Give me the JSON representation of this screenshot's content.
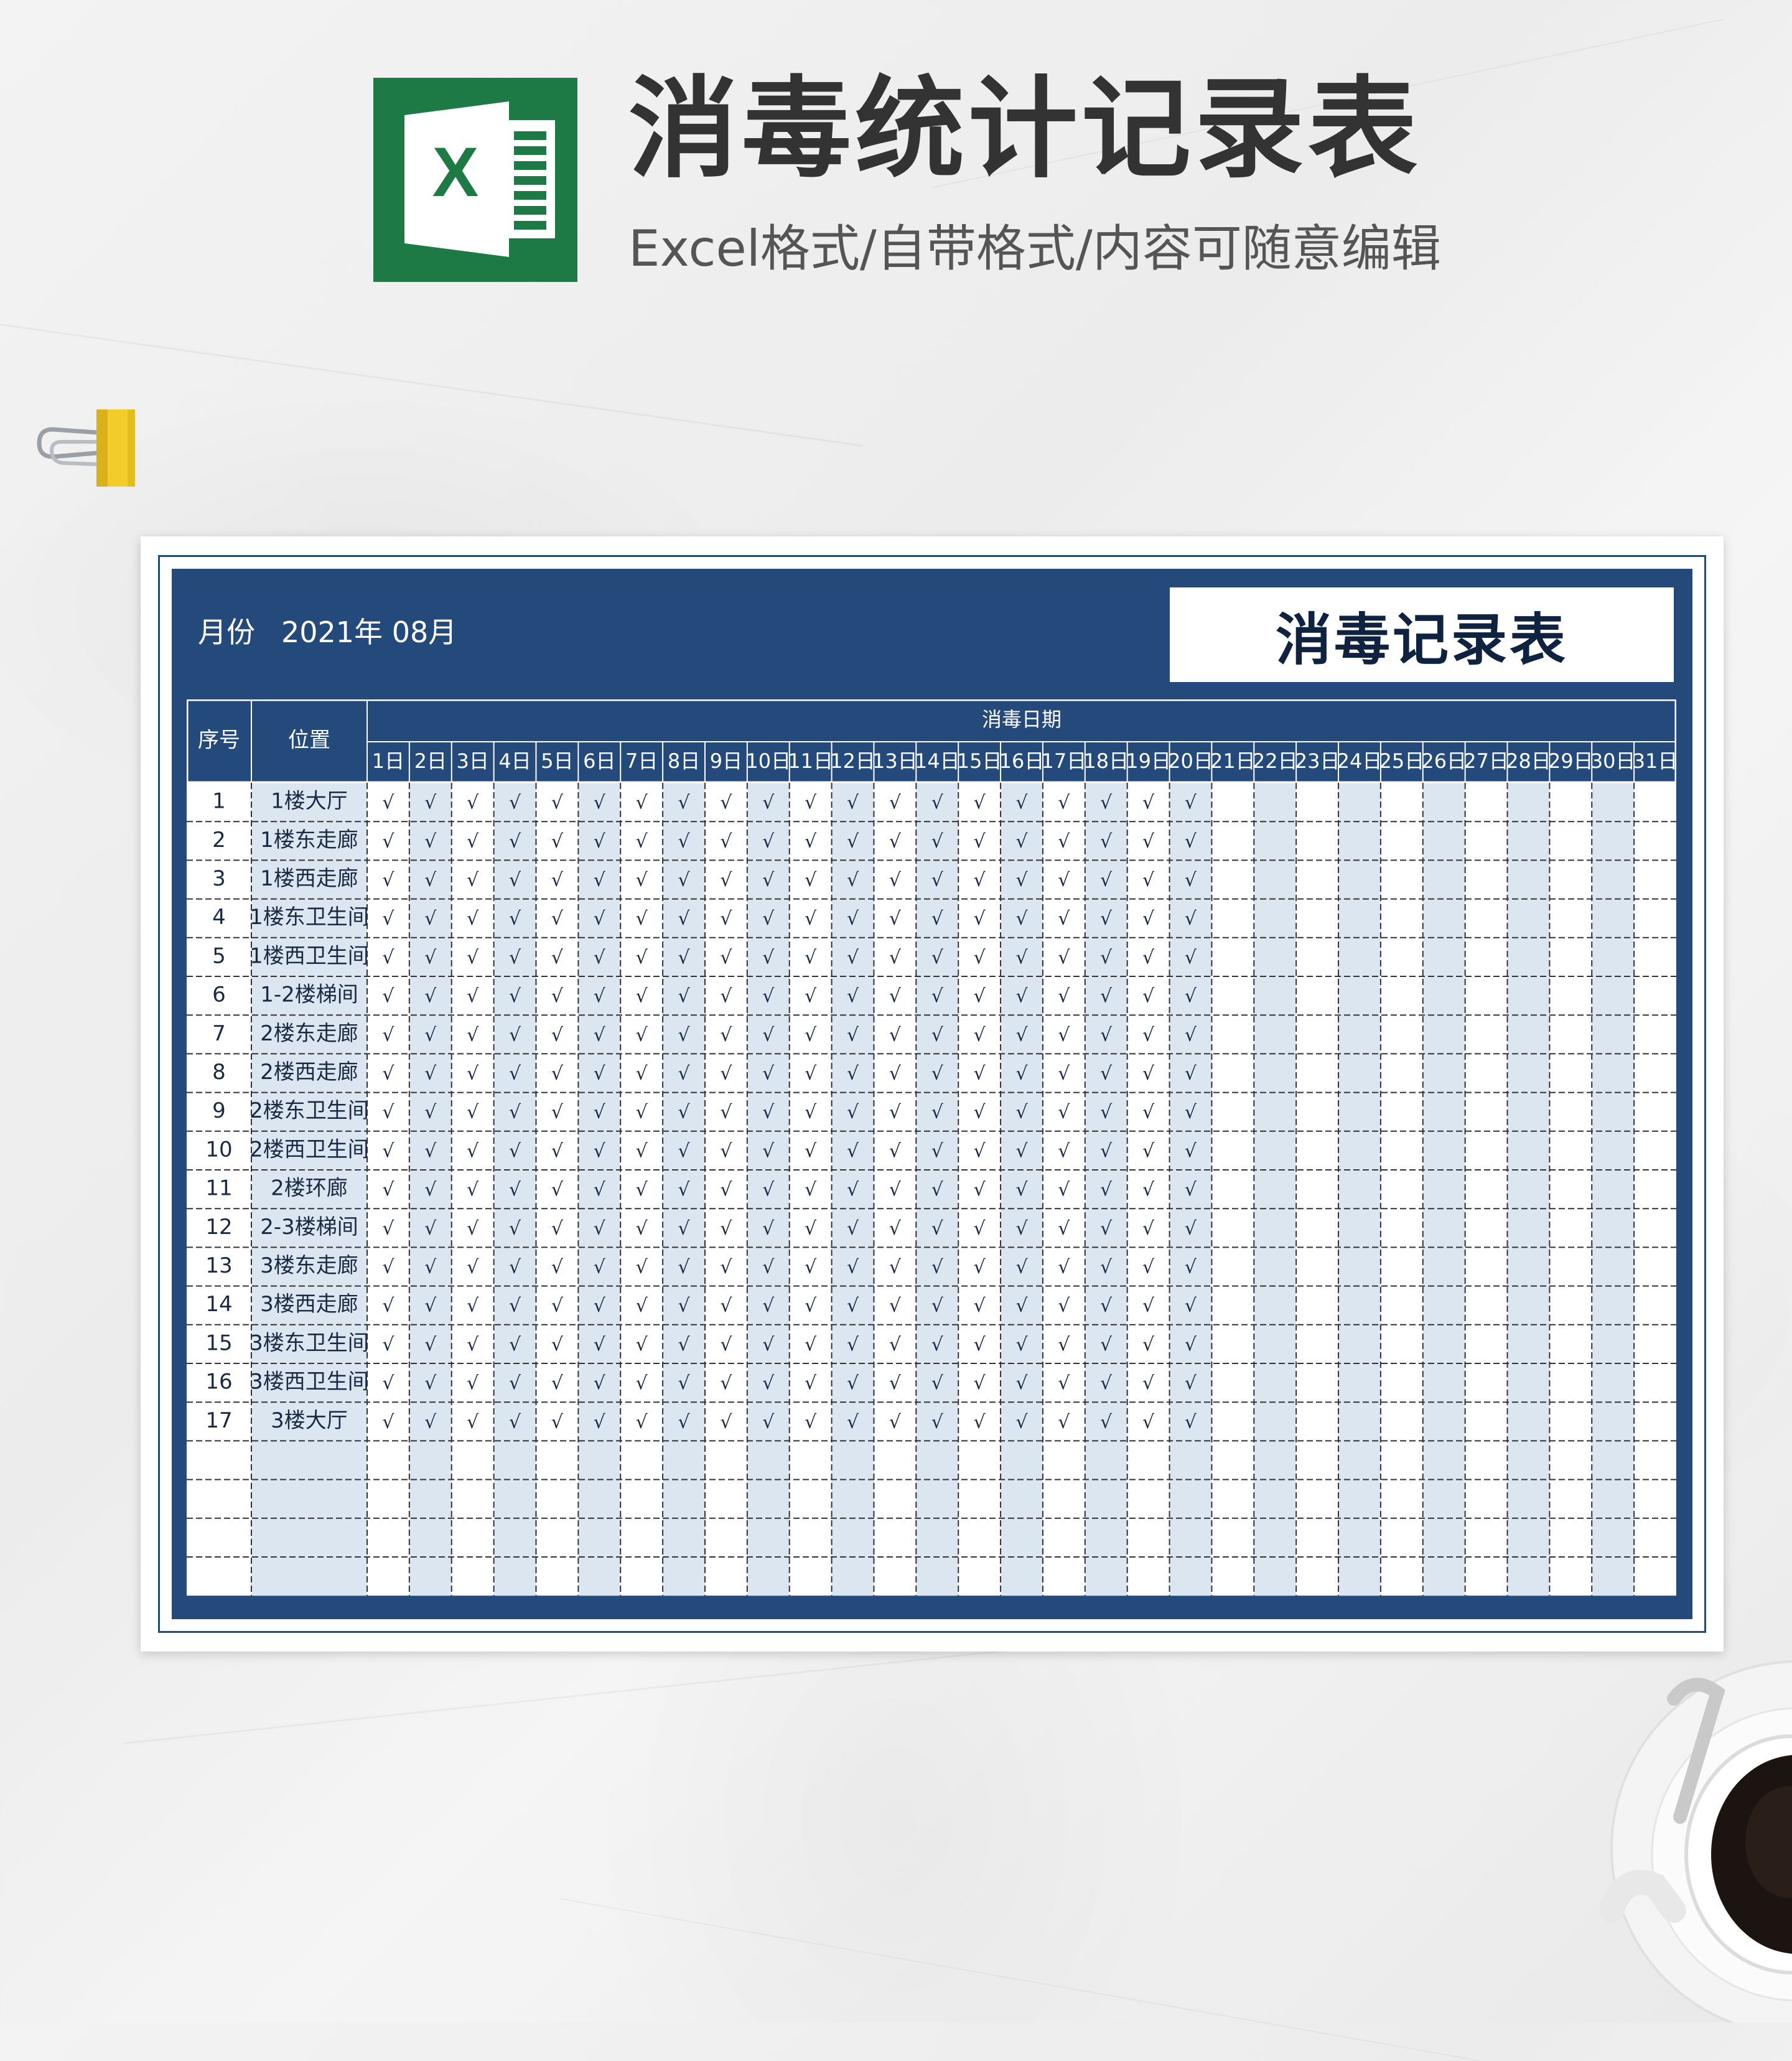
{
  "header": {
    "title": "消毒统计记录表",
    "subtitle": "Excel格式/自带格式/内容可随意编辑",
    "logo_letter": "X"
  },
  "colors": {
    "excel_green": "#1e7a45",
    "panel_navy": "#244a7c",
    "stripe_blue": "#dce6f1"
  },
  "icons": [
    "excel-logo-icon",
    "binder-clip-icon",
    "coffee-cup-icon"
  ],
  "sheet": {
    "month_label": "月份",
    "month_value": "2021年 08月",
    "title": "消毒记录表",
    "header_seq": "序号",
    "header_location": "位置",
    "header_dates": "消毒日期",
    "check_mark": "√",
    "days": [
      "1日",
      "2日",
      "3日",
      "4日",
      "5日",
      "6日",
      "7日",
      "8日",
      "9日",
      "10日",
      "11日",
      "12日",
      "13日",
      "14日",
      "15日",
      "16日",
      "17日",
      "18日",
      "19日",
      "20日",
      "21日",
      "22日",
      "23日",
      "24日",
      "25日",
      "26日",
      "27日",
      "28日",
      "29日",
      "30日",
      "31日"
    ],
    "checked_days_count": 20,
    "empty_rows": 4,
    "rows": [
      {
        "seq": "1",
        "location": "1楼大厅"
      },
      {
        "seq": "2",
        "location": "1楼东走廊"
      },
      {
        "seq": "3",
        "location": "1楼西走廊"
      },
      {
        "seq": "4",
        "location": "1楼东卫生间"
      },
      {
        "seq": "5",
        "location": "1楼西卫生间"
      },
      {
        "seq": "6",
        "location": "1-2楼梯间"
      },
      {
        "seq": "7",
        "location": "2楼东走廊"
      },
      {
        "seq": "8",
        "location": "2楼西走廊"
      },
      {
        "seq": "9",
        "location": "2楼东卫生间"
      },
      {
        "seq": "10",
        "location": "2楼西卫生间"
      },
      {
        "seq": "11",
        "location": "2楼环廊"
      },
      {
        "seq": "12",
        "location": "2-3楼梯间"
      },
      {
        "seq": "13",
        "location": "3楼东走廊"
      },
      {
        "seq": "14",
        "location": "3楼西走廊"
      },
      {
        "seq": "15",
        "location": "3楼东卫生间"
      },
      {
        "seq": "16",
        "location": "3楼西卫生间"
      },
      {
        "seq": "17",
        "location": "3楼大厅"
      }
    ]
  }
}
